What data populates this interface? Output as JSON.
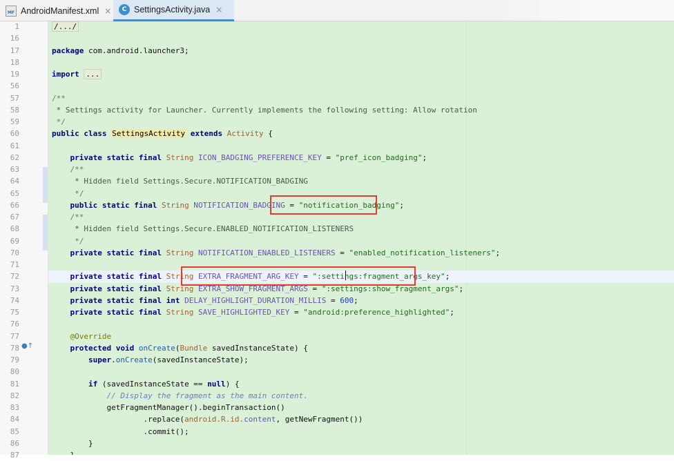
{
  "tabs": [
    {
      "name": "AndroidManifest.xml",
      "icon": "mf-file-icon",
      "icon_text": "MF",
      "active": false
    },
    {
      "name": "SettingsActivity.java",
      "icon": "java-class-icon",
      "icon_text": "C",
      "active": true
    }
  ],
  "tab_close_glyph": "×",
  "colors": {
    "code_bg": "#daf0d7",
    "keyword": "#000080",
    "string": "#1f6b1f",
    "field": "#6a52b0",
    "highlight_box": "#e53935",
    "active_tab": "#dbe7f5"
  },
  "lines": [
    {
      "num": "1",
      "t": [
        "/.../"
      ]
    },
    {
      "num": "16",
      "t": [
        ""
      ]
    },
    {
      "num": "17",
      "t": [
        "package",
        " com.android.launcher3;"
      ]
    },
    {
      "num": "18",
      "t": [
        ""
      ]
    },
    {
      "num": "19",
      "t": [
        "import",
        " ",
        "..."
      ]
    },
    {
      "num": "56",
      "t": [
        ""
      ]
    },
    {
      "num": "57",
      "t": [
        "/**"
      ]
    },
    {
      "num": "58",
      "t": [
        " * Settings activity for Launcher. Currently implements the following setting: Allow rotation"
      ]
    },
    {
      "num": "59",
      "t": [
        " */"
      ]
    },
    {
      "num": "60",
      "t": [
        "public class",
        " ",
        "SettingsActivity",
        " ",
        "extends",
        " ",
        "Activity",
        " {"
      ]
    },
    {
      "num": "61",
      "t": [
        ""
      ]
    },
    {
      "num": "62",
      "t": [
        "    ",
        "private static final",
        " ",
        "String",
        " ",
        "ICON_BADGING_PREFERENCE_KEY",
        " = ",
        "\"pref_icon_badging\"",
        ";"
      ]
    },
    {
      "num": "63",
      "t": [
        "    /**"
      ]
    },
    {
      "num": "64",
      "t": [
        "     * Hidden field Settings.Secure.NOTIFICATION_BADGING"
      ]
    },
    {
      "num": "65",
      "t": [
        "     */"
      ]
    },
    {
      "num": "66",
      "t": [
        "    ",
        "public static final",
        " ",
        "String",
        " ",
        "NOTIFICATION_BADGING",
        " = ",
        "\"notification_badging\"",
        ";"
      ]
    },
    {
      "num": "67",
      "t": [
        "    /**"
      ]
    },
    {
      "num": "68",
      "t": [
        "     * Hidden field Settings.Secure.ENABLED_NOTIFICATION_LISTENERS"
      ]
    },
    {
      "num": "69",
      "t": [
        "     */"
      ]
    },
    {
      "num": "70",
      "t": [
        "    ",
        "private static final",
        " ",
        "String",
        " ",
        "NOTIFICATION_ENABLED_LISTENERS",
        " = ",
        "\"enabled_notification_listeners\"",
        ";"
      ]
    },
    {
      "num": "71",
      "t": [
        ""
      ]
    },
    {
      "num": "72",
      "t": [
        "    ",
        "private static final",
        " ",
        "String",
        " ",
        "EXTRA_FRAGMENT_ARG_KEY",
        " = ",
        "\":settings:fragment_args_key\"",
        ";"
      ]
    },
    {
      "num": "73",
      "t": [
        "    ",
        "private static final",
        " ",
        "String",
        " ",
        "EXTRA_SHOW_FRAGMENT_ARGS",
        " = ",
        "\":settings:show_fragment_args\"",
        ";"
      ]
    },
    {
      "num": "74",
      "t": [
        "    ",
        "private static final int",
        " ",
        "DELAY_HIGHLIGHT_DURATION_MILLIS",
        " = ",
        "600",
        ";"
      ]
    },
    {
      "num": "75",
      "t": [
        "    ",
        "private static final",
        " ",
        "String",
        " ",
        "SAVE_HIGHLIGHTED_KEY",
        " = ",
        "\"android:preference_highlighted\"",
        ";"
      ]
    },
    {
      "num": "76",
      "t": [
        ""
      ]
    },
    {
      "num": "77",
      "t": [
        "    ",
        "@Override"
      ]
    },
    {
      "num": "78",
      "t": [
        "    ",
        "protected void",
        " ",
        "onCreate",
        "(",
        "Bundle",
        " savedInstanceState) {"
      ]
    },
    {
      "num": "79",
      "t": [
        "        ",
        "super",
        ".",
        "onCreate",
        "(savedInstanceState);"
      ]
    },
    {
      "num": "80",
      "t": [
        ""
      ]
    },
    {
      "num": "81",
      "t": [
        "        ",
        "if",
        " (savedInstanceState == ",
        "null",
        ") {"
      ]
    },
    {
      "num": "82",
      "t": [
        "            ",
        "// Display the fragment as the main content."
      ]
    },
    {
      "num": "83",
      "t": [
        "            getFragmentManager().beginTransaction()"
      ]
    },
    {
      "num": "84",
      "t": [
        "                    .replace(",
        "android.R.id.",
        "content",
        ", getNewFragment())"
      ]
    },
    {
      "num": "85",
      "t": [
        "                    .commit();"
      ]
    },
    {
      "num": "86",
      "t": [
        "        }"
      ]
    },
    {
      "num": "87",
      "t": [
        "    }"
      ]
    }
  ],
  "gutter_icons": [
    "lightbulb-icon",
    "override-arrow-icon"
  ],
  "override_glyph": "●↑"
}
